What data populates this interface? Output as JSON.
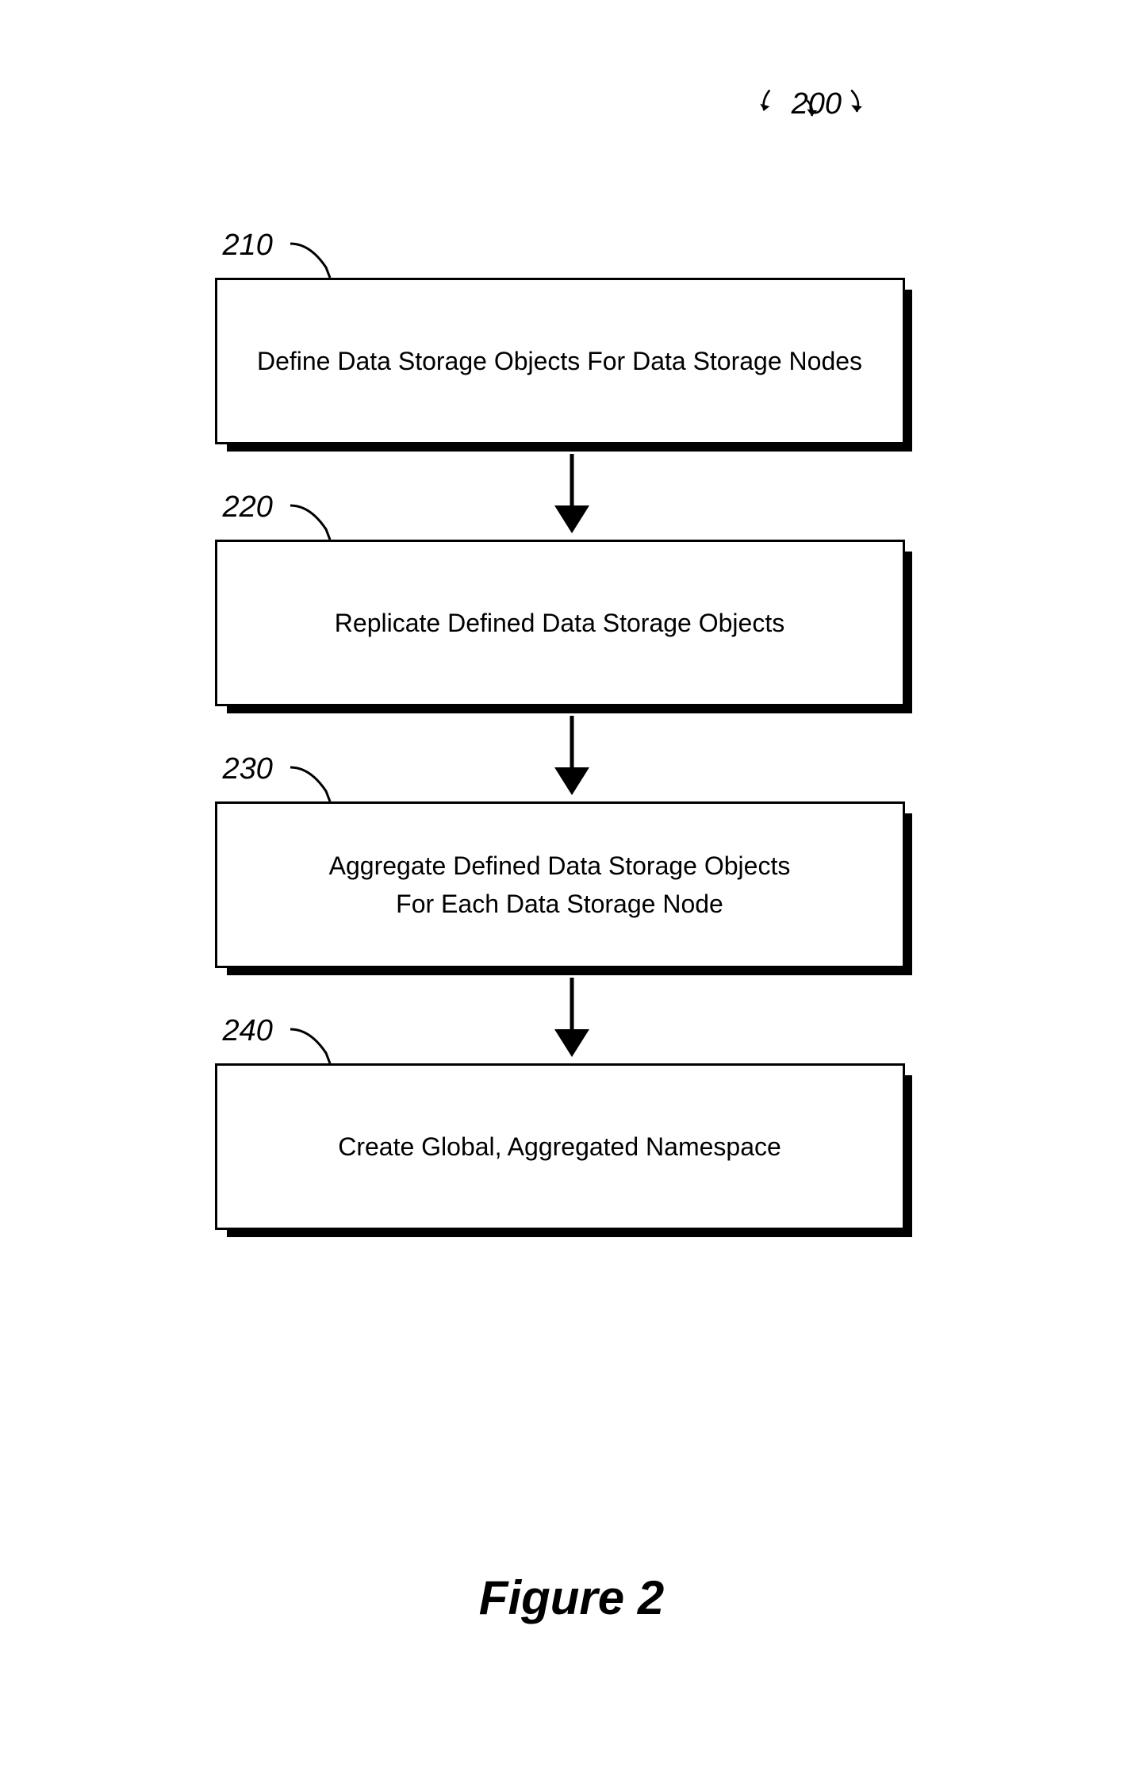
{
  "diagram": {
    "ref": "200",
    "title": "Figure 2",
    "steps": [
      {
        "label": "210",
        "text": "Define Data Storage Objects For Data Storage Nodes"
      },
      {
        "label": "220",
        "text": "Replicate Defined Data Storage Objects"
      },
      {
        "label": "230",
        "text": "Aggregate Defined Data Storage Objects\nFor Each Data Storage Node"
      },
      {
        "label": "240",
        "text": "Create Global, Aggregated Namespace"
      }
    ]
  },
  "chart_data": {
    "type": "flowchart",
    "title": "Figure 2",
    "reference": "200",
    "nodes": [
      {
        "id": "210",
        "label": "Define Data Storage Objects For Data Storage Nodes"
      },
      {
        "id": "220",
        "label": "Replicate Defined Data Storage Objects"
      },
      {
        "id": "230",
        "label": "Aggregate Defined Data Storage Objects For Each Data Storage Node"
      },
      {
        "id": "240",
        "label": "Create Global, Aggregated Namespace"
      }
    ],
    "edges": [
      {
        "from": "210",
        "to": "220"
      },
      {
        "from": "220",
        "to": "230"
      },
      {
        "from": "230",
        "to": "240"
      }
    ]
  }
}
